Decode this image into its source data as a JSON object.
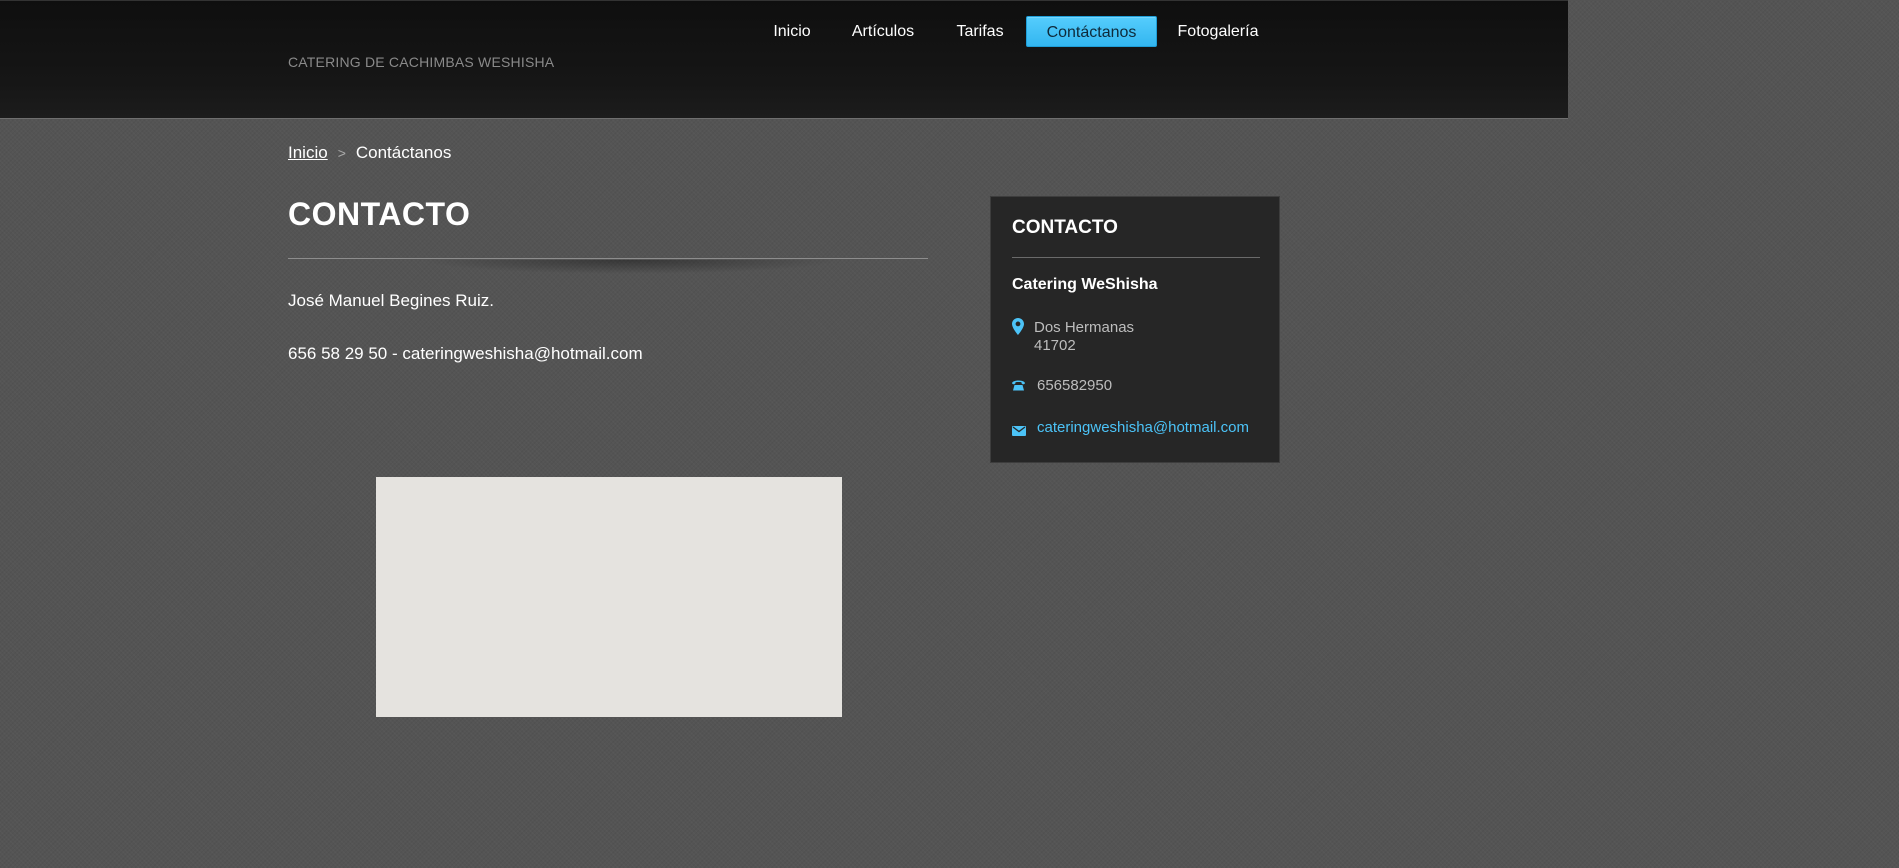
{
  "header": {
    "site_title": "CATERING DE CACHIMBAS WESHISHA",
    "nav": [
      {
        "label": "Inicio"
      },
      {
        "label": "Artículos"
      },
      {
        "label": "Tarifas"
      },
      {
        "label": "Contáctanos",
        "active": true
      },
      {
        "label": "Fotogalería"
      }
    ]
  },
  "breadcrumb": {
    "home": "Inicio",
    "separator": ">",
    "current": "Contáctanos"
  },
  "main": {
    "title": "CONTACTO",
    "name": "José Manuel Begines Ruiz.",
    "contact_line": "656 58 29 50 - cateringweshisha@hotmail.com"
  },
  "sidebar": {
    "title": "CONTACTO",
    "company": "Catering WeShisha",
    "city": "Dos Hermanas",
    "postal_code": "41702",
    "phone": "656582950",
    "email": "cateringweshisha@hotmail.com",
    "icons": {
      "location": "map-pin-icon",
      "phone": "phone-icon",
      "email": "mail-icon"
    }
  },
  "colors": {
    "accent": "#44c0f5",
    "header_bg": "#111111",
    "page_bg": "#545454",
    "sidebar_bg": "#262626",
    "map_placeholder": "#e5e3df"
  }
}
